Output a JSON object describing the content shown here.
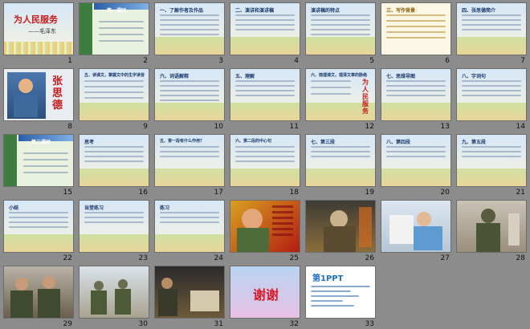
{
  "view": "slide-sorter",
  "slides": [
    {
      "number": "1",
      "title": "为人民服务",
      "subtitle": "——毛泽东"
    },
    {
      "number": "2",
      "title": "第一课时"
    },
    {
      "number": "3",
      "title": "一、了解作者及作品"
    },
    {
      "number": "4",
      "title": "二、演讲和演讲稿"
    },
    {
      "number": "5",
      "title": "演讲稿的特点"
    },
    {
      "number": "6",
      "title": "三、写作背景"
    },
    {
      "number": "7",
      "title": "四、张思德简介"
    },
    {
      "number": "8",
      "title": "张思德"
    },
    {
      "number": "9",
      "title": "五、读课文，掌握文中的生字读音"
    },
    {
      "number": "10",
      "title": "六、词语解释"
    },
    {
      "number": "11",
      "title": "五、理解"
    },
    {
      "number": "12",
      "title": "六、梳理课文，理清文章的脉络",
      "side_label": "为人民服务"
    },
    {
      "number": "13",
      "title": "七、思维导图"
    },
    {
      "number": "14",
      "title": "八、字词句"
    },
    {
      "number": "15",
      "title": "第二课时"
    },
    {
      "number": "16",
      "title": "思考"
    },
    {
      "number": "17",
      "title": "五、第一段有什么作用？"
    },
    {
      "number": "18",
      "title": "六、第二段的中心句"
    },
    {
      "number": "19",
      "title": "七、第三段"
    },
    {
      "number": "20",
      "title": "八、第四段"
    },
    {
      "number": "21",
      "title": "九、第五段"
    },
    {
      "number": "22",
      "title": "小结"
    },
    {
      "number": "23",
      "title": "当堂练习"
    },
    {
      "number": "24",
      "title": "练习"
    },
    {
      "number": "25",
      "title": ""
    },
    {
      "number": "26",
      "title": ""
    },
    {
      "number": "27",
      "title": ""
    },
    {
      "number": "28",
      "title": ""
    },
    {
      "number": "29",
      "title": ""
    },
    {
      "number": "30",
      "title": ""
    },
    {
      "number": "31",
      "title": ""
    },
    {
      "number": "32",
      "title": "谢谢"
    },
    {
      "number": "33",
      "title": "第1PPT"
    }
  ]
}
